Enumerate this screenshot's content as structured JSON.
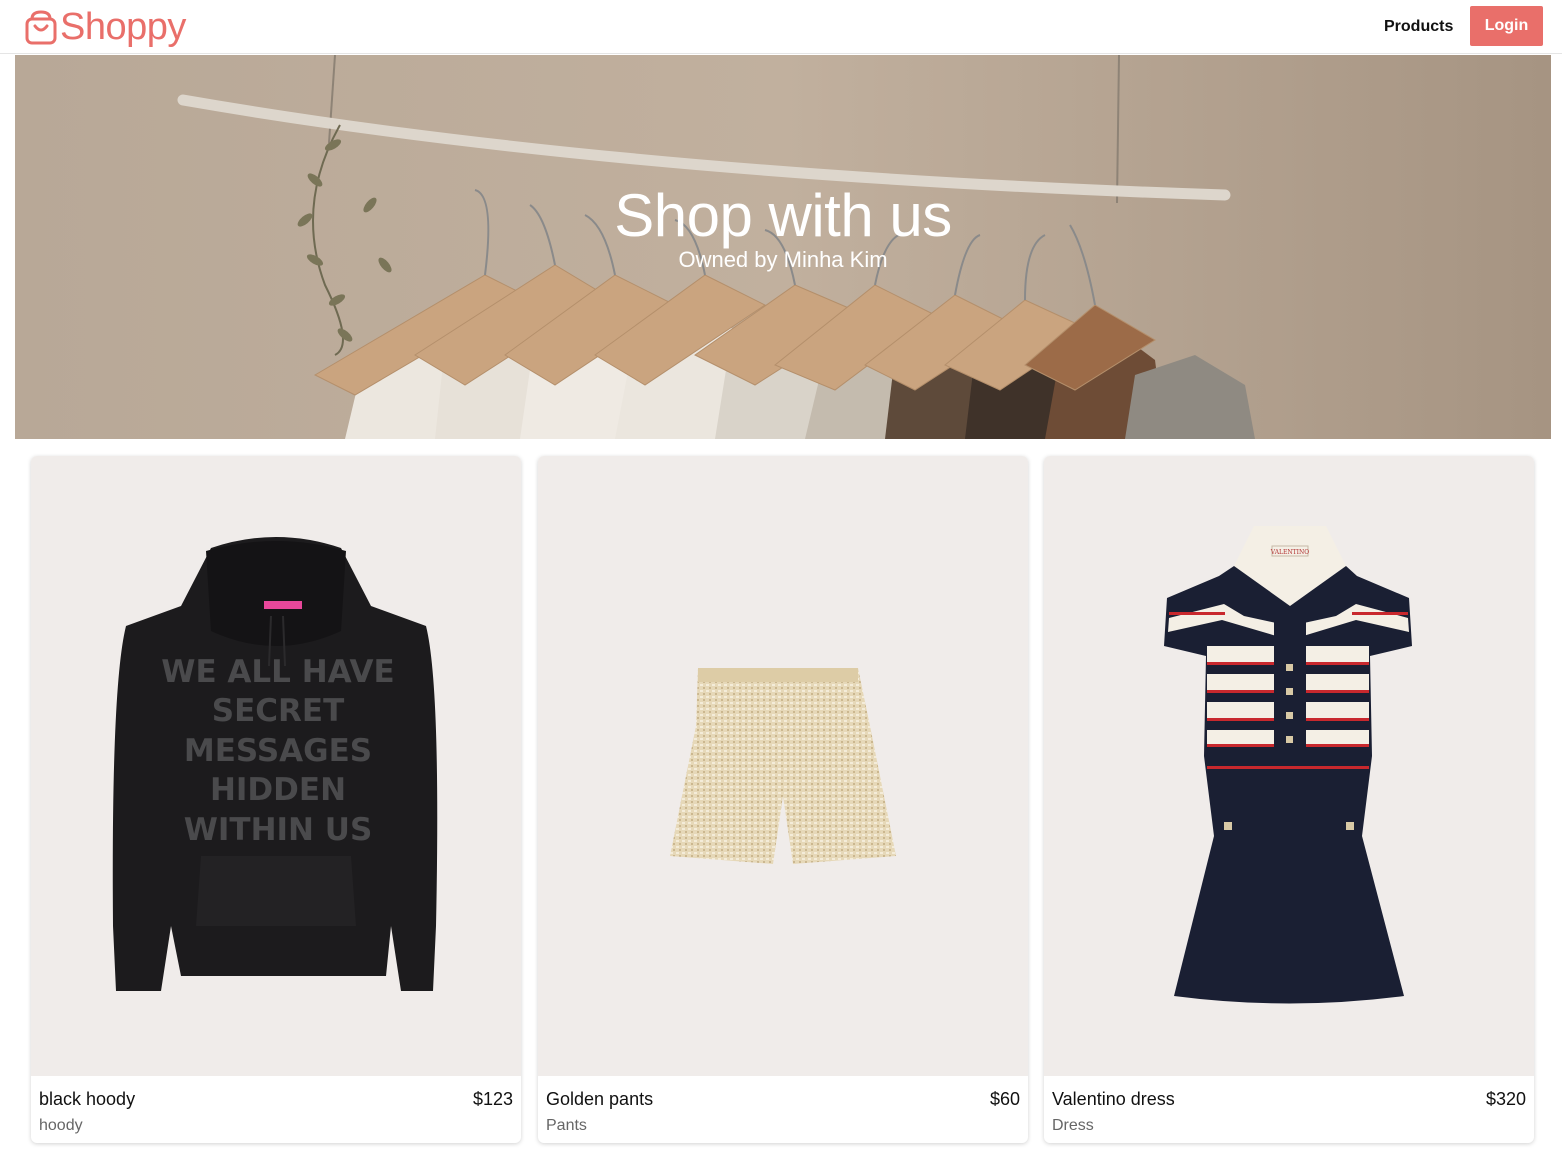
{
  "header": {
    "logo_text": "Shoppy",
    "nav_products": "Products",
    "login_label": "Login"
  },
  "banner": {
    "title": "Shop with us",
    "subtitle": "Owned by Minha Kim"
  },
  "products": [
    {
      "name": "black hoody",
      "price": "$123",
      "category": "hoody",
      "image": "hoodie-image",
      "print_text": [
        "WE ALL HAVE",
        "SECRET",
        "MESSAGES",
        "HIDDEN",
        "WITHIN US"
      ]
    },
    {
      "name": "Golden pants",
      "price": "$60",
      "category": "Pants",
      "image": "shorts-image"
    },
    {
      "name": "Valentino dress",
      "price": "$320",
      "category": "Dress",
      "image": "dress-image",
      "label_text": "VALENTINO"
    }
  ],
  "colors": {
    "accent": "#e96f6a",
    "card_bg": "#f0ecea"
  }
}
